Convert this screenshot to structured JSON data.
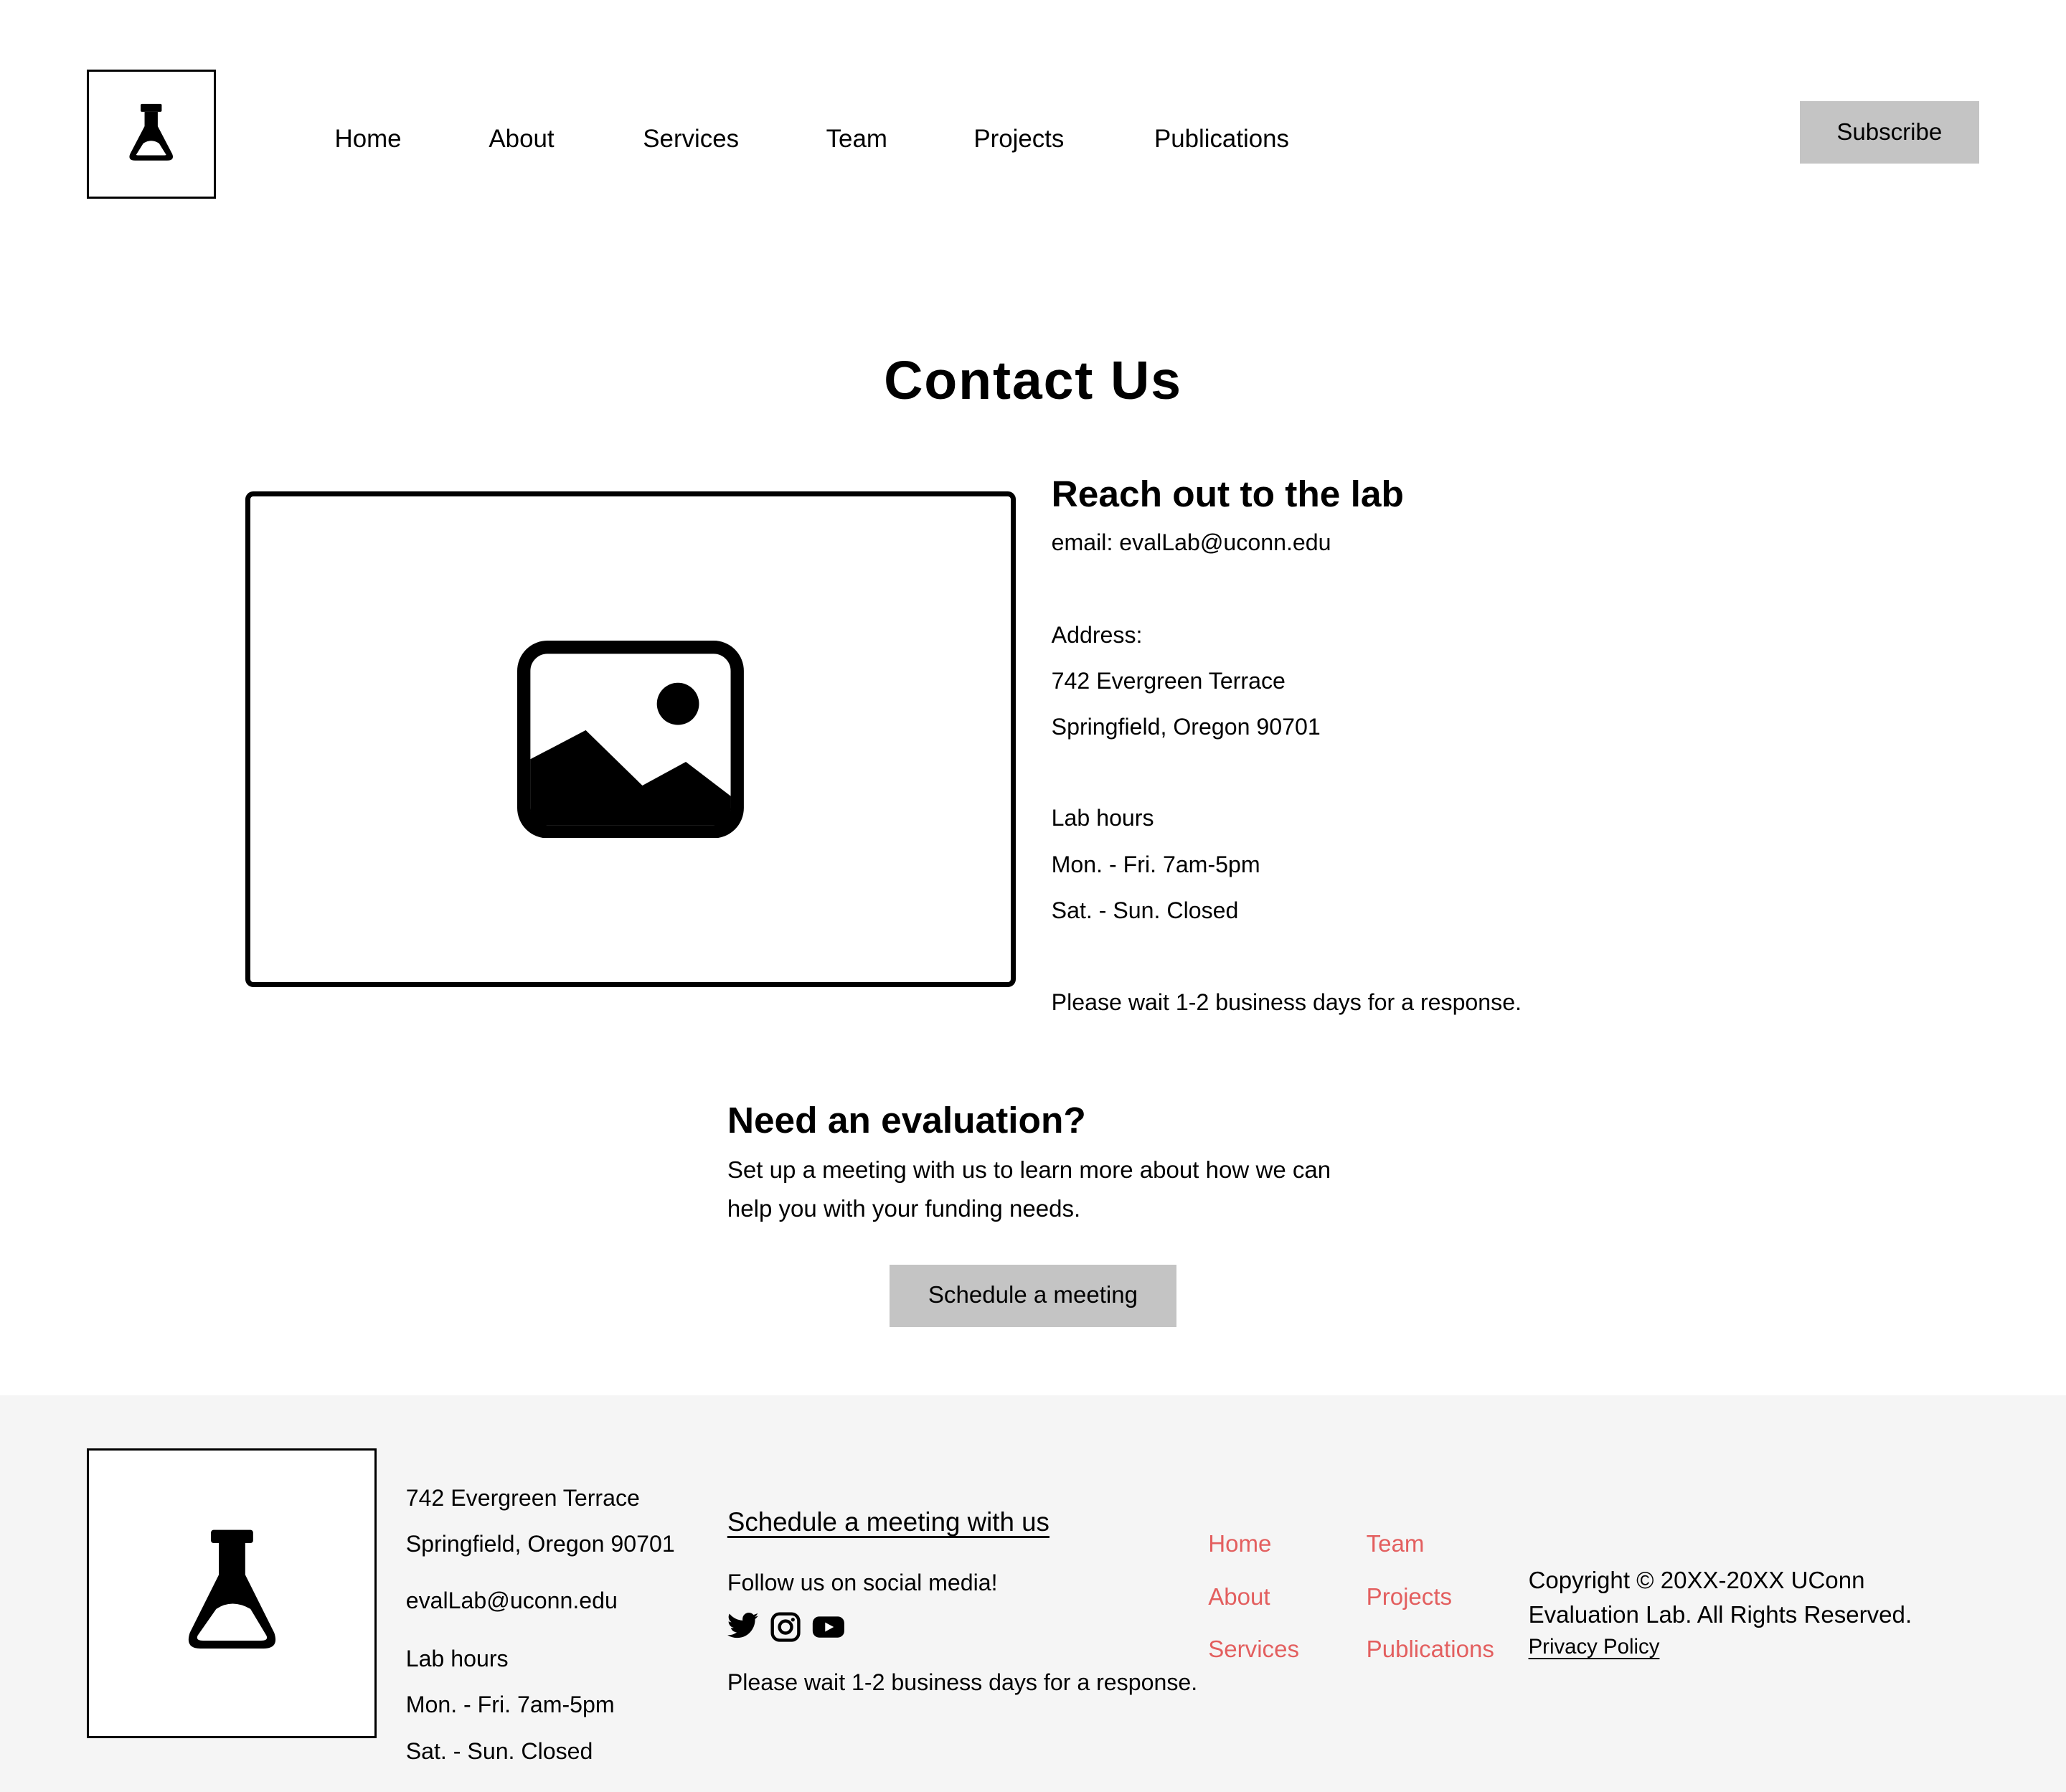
{
  "header": {
    "nav": [
      "Home",
      "About",
      "Services",
      "Team",
      "Projects",
      "Publications"
    ],
    "subscribe_label": "Subscribe",
    "logo_icon": "flask-icon"
  },
  "main": {
    "title": "Contact Us",
    "image_icon": "image-placeholder-icon",
    "contact": {
      "heading": "Reach out to the lab",
      "email": "email: evalLab@uconn.edu",
      "address_label": "Address:",
      "address_line1": "742 Evergreen Terrace",
      "address_line2": "Springfield, Oregon 90701",
      "hours_label": "Lab hours",
      "hours_weekday": "Mon. - Fri. 7am-5pm",
      "hours_weekend": "Sat. - Sun. Closed",
      "response_note": "Please wait 1-2 business days for a response."
    },
    "evaluation": {
      "heading": "Need an evaluation?",
      "description": "Set up a meeting with us to learn more about how we can help you with your funding needs.",
      "button_label": "Schedule a meeting"
    }
  },
  "footer": {
    "address_line1": "742 Evergreen Terrace",
    "address_line2": "Springfield, Oregon 90701",
    "email": "evalLab@uconn.edu",
    "hours_label": "Lab hours",
    "hours_weekday": "Mon. - Fri. 7am-5pm",
    "hours_weekend": "Sat. - Sun. Closed",
    "schedule_link": "Schedule a meeting with us",
    "social_label": "Follow us on social media!",
    "social_icons": [
      "twitter-icon",
      "instagram-icon",
      "youtube-icon"
    ],
    "response_note": "Please wait 1-2 business days for a response.",
    "nav_col1": [
      "Home",
      "About",
      "Services"
    ],
    "nav_col2": [
      "Team",
      "Projects",
      "Publications"
    ],
    "copyright": "Copyright © 20XX-20XX UConn Evaluation Lab. All Rights Reserved.",
    "privacy_label": "Privacy Policy",
    "link_color": "#e35f5f"
  }
}
